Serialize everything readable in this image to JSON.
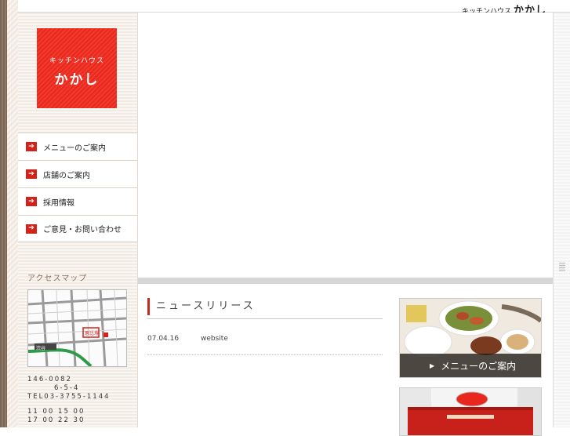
{
  "header": {
    "brand_kana": "キッチンハウス",
    "brand_script": "かかし"
  },
  "logo": {
    "line1": "キッチンハウス",
    "line2": "かかし"
  },
  "nav": [
    {
      "label": "メニューのご案内"
    },
    {
      "label": "店舗のご案内"
    },
    {
      "label": "採用情報"
    },
    {
      "label": "ご意見・お問い合わせ"
    }
  ],
  "access": {
    "title": "アクセスマップ",
    "map_labels": [
      "渋谷",
      "恵比寿"
    ],
    "address": [
      "146-0082",
      "6-5-4",
      "TEL03-3755-1144",
      "",
      "11 00 15 00",
      "17 00 22 30"
    ]
  },
  "news": {
    "title": "ニュースリリース",
    "items": [
      {
        "date": "07.04.16",
        "text": "website"
      }
    ]
  },
  "banners": {
    "menu_label": "メニューのご案内"
  },
  "colors": {
    "accent": "#d2231a",
    "logo_red": "#e8281d",
    "sidebar_text": "#8a6f57"
  }
}
